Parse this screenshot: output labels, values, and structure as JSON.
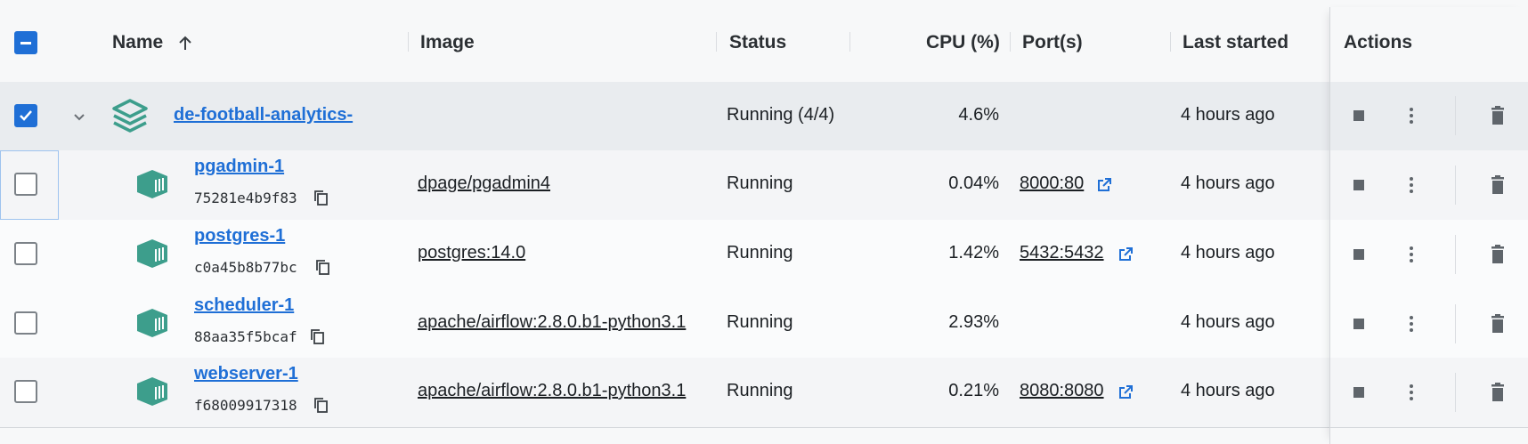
{
  "header": {
    "name": "Name",
    "image": "Image",
    "status": "Status",
    "cpu": "CPU (%)",
    "ports": "Port(s)",
    "last_started": "Last started",
    "actions": "Actions"
  },
  "group": {
    "name": "de-football-analytics-",
    "status": "Running (4/4)",
    "cpu": "4.6%",
    "last_started": "4 hours ago"
  },
  "containers": [
    {
      "name": "pgadmin-1",
      "id": "75281e4b9f83",
      "image": "dpage/pgadmin4",
      "status": "Running",
      "cpu": "0.04%",
      "port": "8000:80",
      "last_started": "4 hours ago"
    },
    {
      "name": "postgres-1",
      "id": "c0a45b8b77bc",
      "image": "postgres:14.0",
      "status": "Running",
      "cpu": "1.42%",
      "port": "5432:5432",
      "last_started": "4 hours ago"
    },
    {
      "name": "scheduler-1",
      "id": "88aa35f5bcaf",
      "image": "apache/airflow:2.8.0.b1-python3.1",
      "status": "Running",
      "cpu": "2.93%",
      "port": "",
      "last_started": "4 hours ago"
    },
    {
      "name": "webserver-1",
      "id": "f68009917318",
      "image": "apache/airflow:2.8.0.b1-python3.1",
      "status": "Running",
      "cpu": "0.21%",
      "port": "8080:8080",
      "last_started": "4 hours ago"
    }
  ],
  "icons": {
    "stack": "stack-icon",
    "container": "container-icon",
    "copy": "copy-icon",
    "external_link": "external-link-icon",
    "stop": "stop-icon",
    "more": "more-vertical-icon",
    "delete": "trash-icon",
    "sort": "sort-arrow-up-icon",
    "chevron": "chevron-down-icon"
  },
  "colors": {
    "accent": "#1f6fd6",
    "container_teal": "#3d9e8c"
  }
}
